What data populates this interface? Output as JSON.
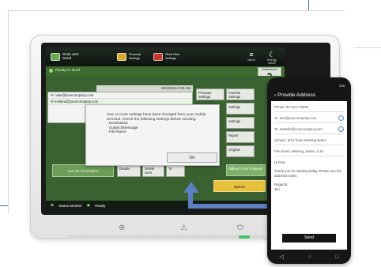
{
  "printer": {
    "topbar": {
      "scan_and_send": "Scan and Send",
      "personal_settings": "Personal Settings",
      "store_files": "Store Files Settings",
      "menu_label": "Menu",
      "sleep_label": "Energy Saver"
    },
    "ready_text": "Ready to send.",
    "destinations_label": "Destinations",
    "destinations_count": "2",
    "date_time": "8/23/2019 9:38 AM",
    "addresses": [
      "i.dan@yourcompany.com",
      "meiland@yourcompany.com"
    ],
    "side_buttons": {
      "previous_settings": "Previous Settings",
      "favorite_settings": "Favorite Settings",
      "settings_1": "Settings",
      "settings_2": "Settings",
      "report": "Report",
      "original": "Original",
      "different_size": "Different Size Originals",
      "options": "Options"
    },
    "bottom_buttons": {
      "specify_destination": "Specify Destination",
      "details": "Details",
      "delete_dest": "Delete Dest.",
      "to": "To"
    },
    "status_bar": {
      "status_monitor": "Status Monitor",
      "ready": "Ready"
    },
    "modal": {
      "message": "One or more settings have been changed from your mobile\nterminal. Check the following settings before sending.\n· Destination\n· Subject/Message\n· File Name",
      "ok_label": "OK"
    }
  },
  "phone": {
    "status_time": "3:05",
    "header_title": "Provide Address",
    "printer_line": "Printer: iR-ADV C5560",
    "to_rows": [
      "To:  dan@yourcompany.com",
      "To:  danielle@yourcompany.com"
    ],
    "subject": "Subject:  8/16 Team Meeting Notes",
    "file_name": "File Name:  Meeting_Notes_4.18",
    "body": "Hi Dan,\n\nThank you for meeting today. Please see the attached notes.\n\nRegards,\nJen",
    "send_label": "Send",
    "nav": [
      "◁",
      "○",
      "□"
    ]
  },
  "colors": {
    "screen_green": "#3a6130",
    "accent_yellow": "#e8c23d",
    "arrow_blue": "#5b7fbf",
    "phone_black": "#151515"
  },
  "icons": [
    "scan-send-icon",
    "personal-settings-icon",
    "store-files-icon",
    "menu-icon",
    "energy-saver-icon",
    "status-monitor-icon",
    "back-icon",
    "arrow-icon"
  ]
}
